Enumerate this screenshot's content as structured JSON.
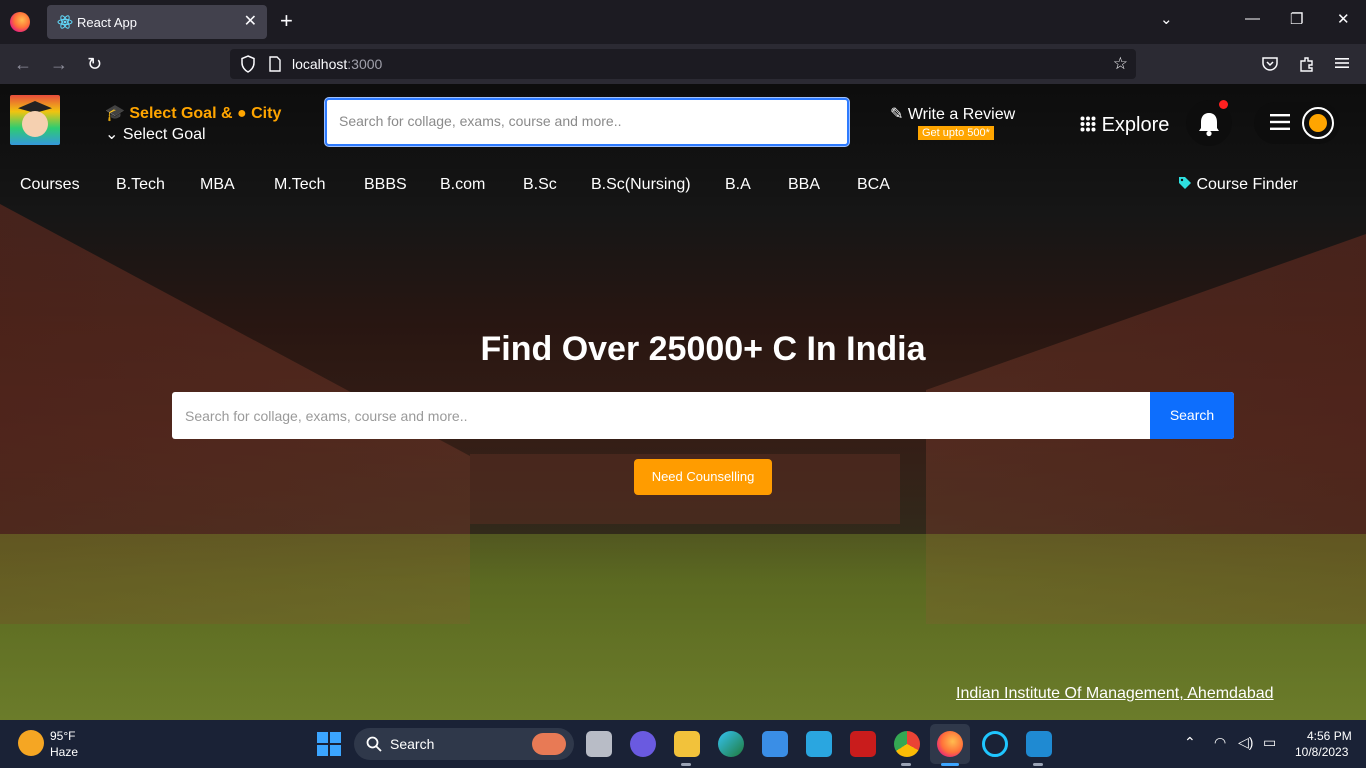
{
  "browser": {
    "tab_title": "React App",
    "url_host": "localhost",
    "url_port": ":3000"
  },
  "header": {
    "goal_title": "Select Goal &",
    "city_label": "City",
    "goal_select_label": "Select Goal",
    "search_placeholder": "Search for collage, exams, course and more..",
    "review_label": "Write a Review",
    "review_badge": "Get upto 500*",
    "explore_label": "Explore",
    "accent_color": "#ffa500"
  },
  "courses": {
    "items": [
      "Courses",
      "B.Tech",
      "MBA",
      "M.Tech",
      "BBBS",
      "B.com",
      "B.Sc",
      "B.Sc(Nursing)",
      "B.A",
      "BBA",
      "BCA"
    ],
    "finder_label": "Course Finder"
  },
  "hero": {
    "title": "Find Over 25000+ C In India",
    "search_placeholder": "Search for collage, exams, course and more..",
    "search_button": "Search",
    "counselling_button": "Need Counselling",
    "image_caption": "Indian Institute Of Management, Ahemdabad",
    "search_button_color": "#0d6efd",
    "counselling_color": "#ff9c00"
  },
  "taskbar": {
    "weather_temp": "95°F",
    "weather_desc": "Haze",
    "search_label": "Search",
    "time": "4:56 PM",
    "date": "10/8/2023"
  }
}
